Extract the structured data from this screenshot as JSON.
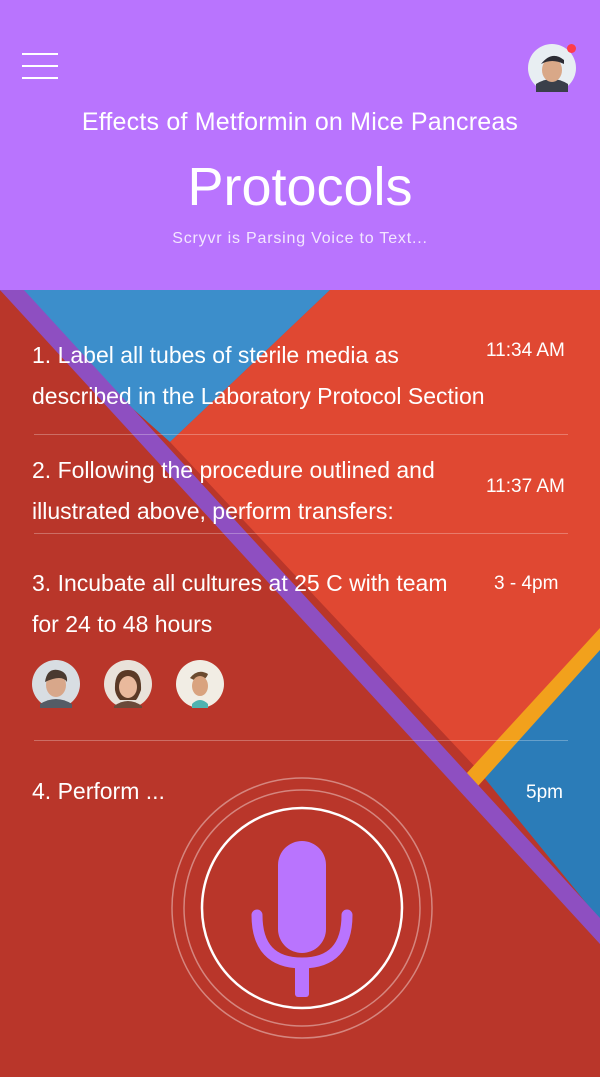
{
  "header": {
    "subtitle": "Effects of Metformin on Mice Pancreas",
    "title": "Protocols",
    "status": "Scryvr is Parsing Voice to Text...",
    "menu_icon": "hamburger-menu-icon",
    "notification_color": "#ff3c4b"
  },
  "colors": {
    "header": "#b974fe",
    "red_dark": "#b9362a",
    "red_light": "#e04832",
    "blue": "#2b7cb8",
    "purple_stripe": "#8e4fc1",
    "orange_stripe": "#f2a11c",
    "mic": "#b974fe"
  },
  "protocols": [
    {
      "text_lines": [
        "1. Label all tubes of sterile media as",
        "described in the Laboratory Protocol Section"
      ],
      "time": "11:34 AM"
    },
    {
      "text_lines": [
        "2. Following the procedure outlined and",
        "illustrated above, perform transfers:"
      ],
      "time": "11:37 AM"
    },
    {
      "text_lines": [
        "3. Incubate all cultures at 25 C with team",
        "for 24 to 48 hours"
      ],
      "time": "3 - 4pm",
      "team": [
        "team-member-1",
        "team-member-2",
        "team-member-3"
      ]
    },
    {
      "text_lines": [
        "4. Perform ..."
      ],
      "time": "5pm"
    }
  ],
  "mic": {
    "icon": "microphone-icon"
  }
}
